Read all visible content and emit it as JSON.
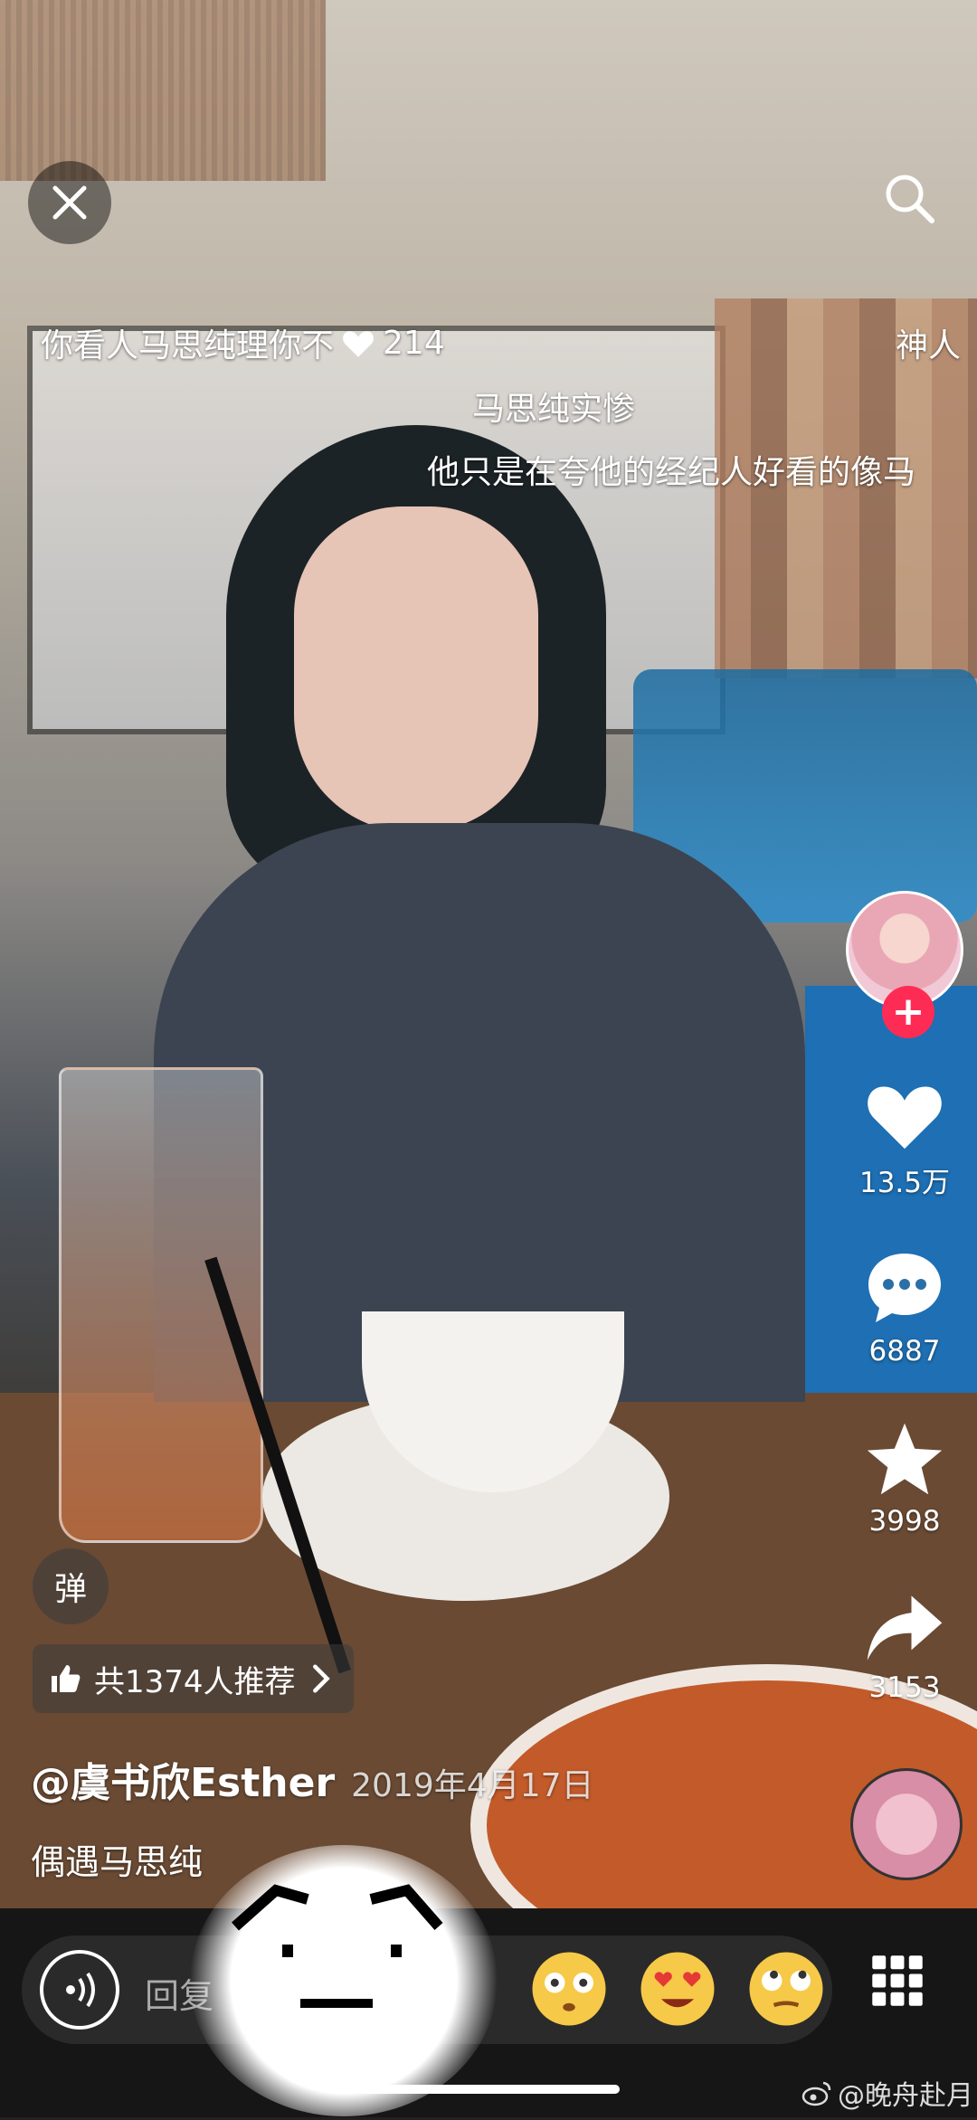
{
  "top": {
    "close_icon": "close-icon",
    "search_icon": "search-icon"
  },
  "danmaku": {
    "line1_text": "你看人马思纯理你不",
    "line1_likes": "214",
    "line2_text": "神人",
    "line3_text": "马思纯实惨",
    "line4_text": "他只是在夸他的经纪人好看的像马"
  },
  "actions": {
    "follow_icon": "plus-icon",
    "like_count": "13.5万",
    "comment_count": "6887",
    "favorite_count": "3998",
    "share_count": "3153"
  },
  "info": {
    "danmu_toggle": "弹",
    "recommend_label": "共1374人推荐",
    "author": "@虞书欣Esther",
    "date": "2019年4月17日",
    "caption": "偶遇马思纯"
  },
  "bottom": {
    "reply_placeholder": "回复",
    "grid_icon": "grid-icon"
  },
  "watermark": "@晚舟赴月",
  "colors": {
    "accent_red": "#fe2c55",
    "bottom_bar": "#161616"
  }
}
